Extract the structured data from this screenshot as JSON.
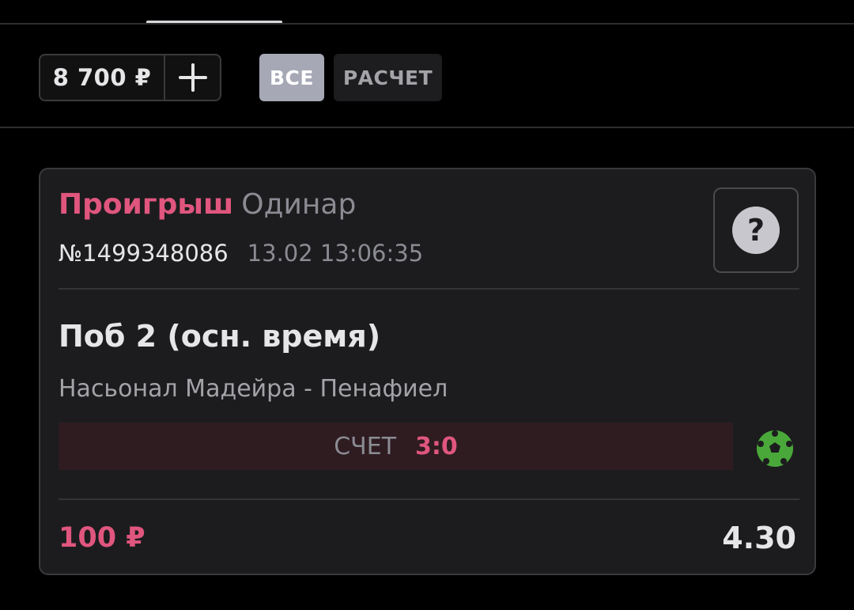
{
  "balance": {
    "amount": "8 700 ₽"
  },
  "filters": {
    "all_label": "ВСЕ",
    "calc_label": "РАСЧЕТ"
  },
  "bet": {
    "status": "Проигрыш",
    "type": "Одинар",
    "number": "№1499348086",
    "datetime": "13.02 13:06:35",
    "help_symbol": "?",
    "outcome": "Поб 2 (осн. время)",
    "match": "Насьонал Мадейра - Пенафиел",
    "score_label": "СЧЕТ",
    "score_value": "3:0",
    "stake": "100 ₽",
    "odds": "4.30",
    "sport_icon": "soccer-ball-icon"
  },
  "colors": {
    "background": "#000000",
    "card": "#1c1c1e",
    "loss_accent": "#e0567e",
    "filter_active": "#a6a8b6",
    "sport_green": "#4aa83a"
  }
}
